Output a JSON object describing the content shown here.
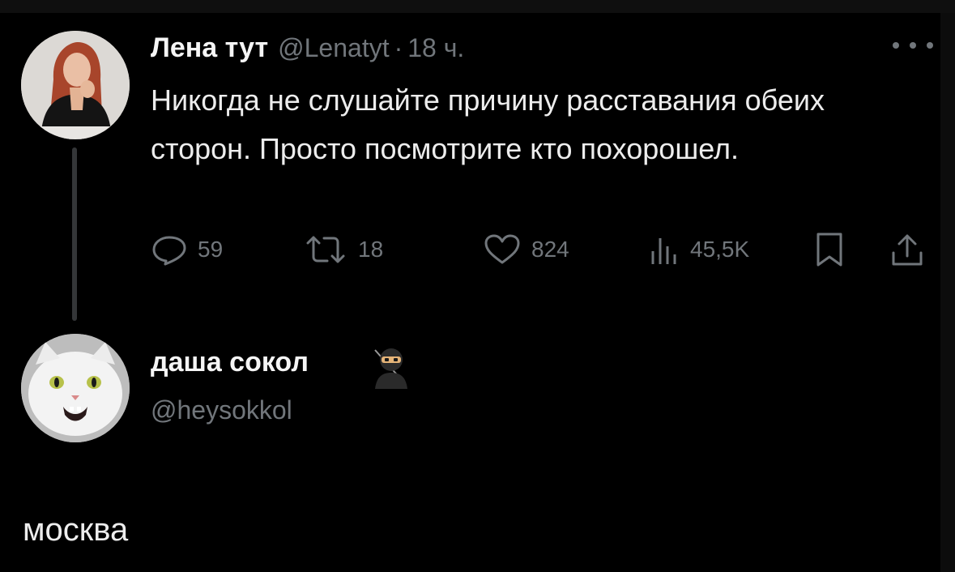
{
  "tweet": {
    "author": {
      "display_name": "Лена тут",
      "handle": "@Lenatyt",
      "separator": "·",
      "time": "18 ч."
    },
    "text": "Никогда не слушайте причину расставания обеих сторон. Просто посмотрите кто похорошел.",
    "actions": {
      "reply_count": "59",
      "retweet_count": "18",
      "like_count": "824",
      "views_count": "45,5K"
    },
    "icons": [
      "reply-icon",
      "retweet-icon",
      "like-icon",
      "views-icon",
      "bookmark-icon",
      "share-icon",
      "more-icon"
    ]
  },
  "reply": {
    "author": {
      "display_name": "даша сокол",
      "emoji": "ninja-emoji",
      "handle": "@heysokkol"
    },
    "text": "москва"
  },
  "colors": {
    "background": "#000000",
    "primary_text": "#e7e9ea",
    "secondary_text": "#71767b",
    "thread_line": "#343638"
  }
}
